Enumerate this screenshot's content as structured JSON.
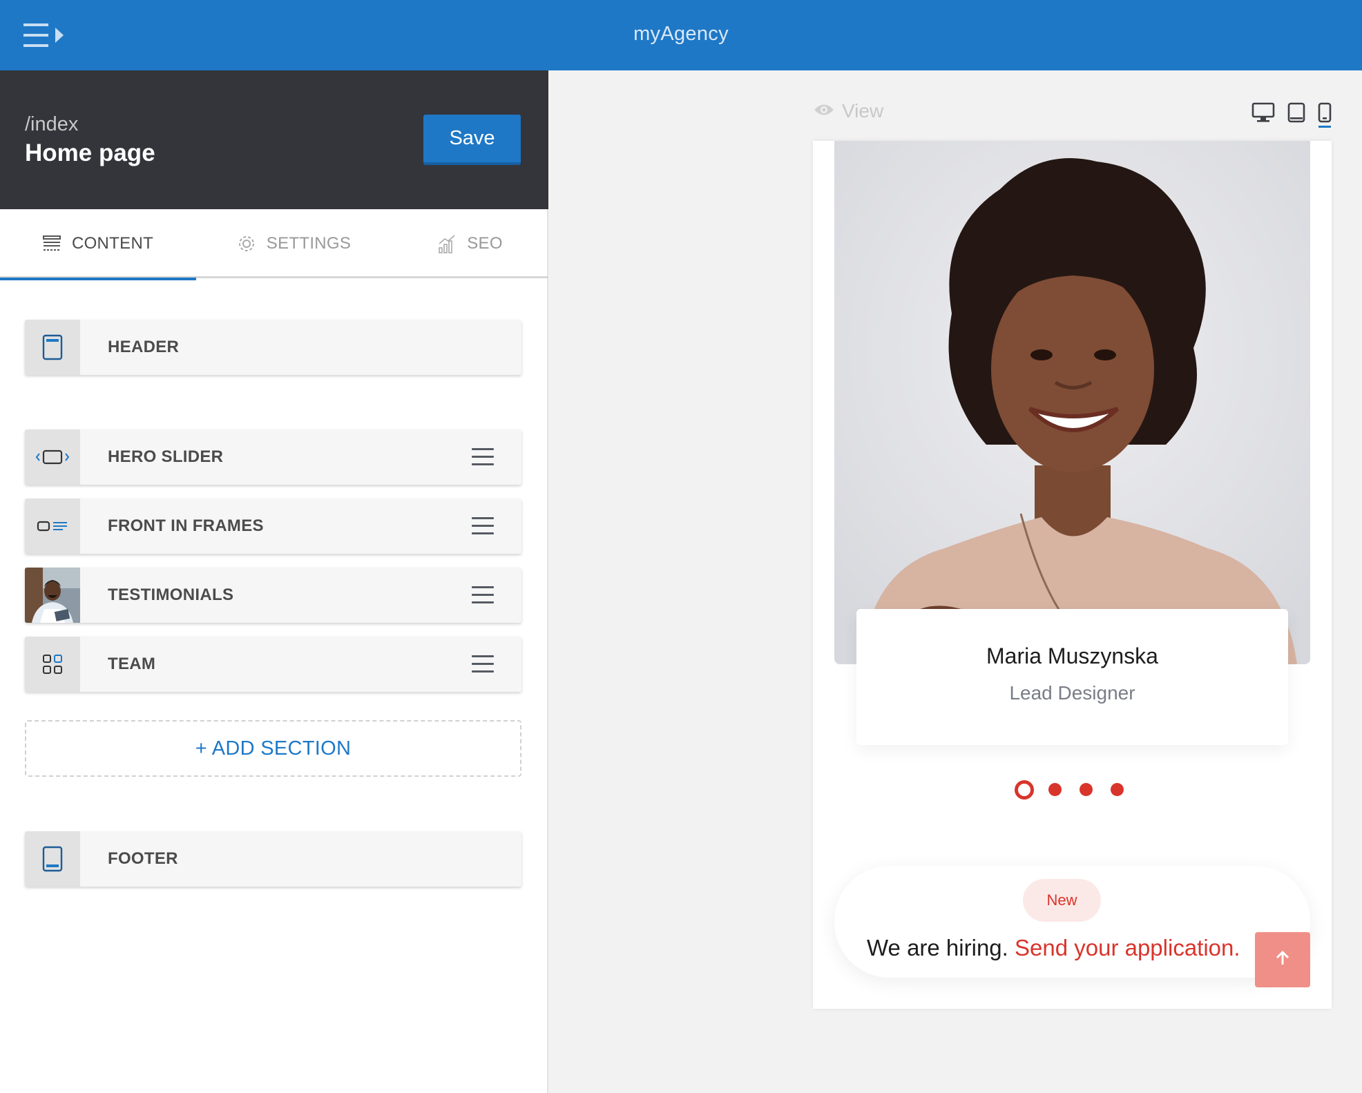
{
  "app": {
    "title": "myAgency"
  },
  "page": {
    "path": "/index",
    "title": "Home page",
    "save_label": "Save"
  },
  "tabs": [
    {
      "label": "CONTENT",
      "icon": "content-icon",
      "active": true
    },
    {
      "label": "SETTINGS",
      "icon": "gear-icon",
      "active": false
    },
    {
      "label": "SEO",
      "icon": "chart-icon",
      "active": false
    }
  ],
  "sections": {
    "header": {
      "label": "HEADER",
      "icon": "header-layout-icon"
    },
    "items": [
      {
        "label": "HERO SLIDER",
        "icon": "slider-icon"
      },
      {
        "label": "FRONT IN FRAMES",
        "icon": "frames-icon"
      },
      {
        "label": "TESTIMONIALS",
        "icon": "testimonial-thumbnail"
      },
      {
        "label": "TEAM",
        "icon": "grid-icon"
      }
    ],
    "add_label": "+ ADD SECTION",
    "footer": {
      "label": "FOOTER",
      "icon": "footer-layout-icon"
    }
  },
  "preview": {
    "view_label": "View",
    "devices": [
      "desktop-icon",
      "tablet-icon",
      "mobile-icon"
    ],
    "active_device": "mobile",
    "person": {
      "name": "Maria Muszynska",
      "role": "Lead Designer"
    },
    "slider": {
      "count": 4,
      "active": 1
    },
    "hiring": {
      "badge": "New",
      "text": "We are hiring.",
      "link": "Send your application."
    }
  },
  "colors": {
    "brand": "#1e78c6",
    "dark": "#33353a",
    "accent": "#d9342b",
    "scroll_button": "#f08f87"
  }
}
